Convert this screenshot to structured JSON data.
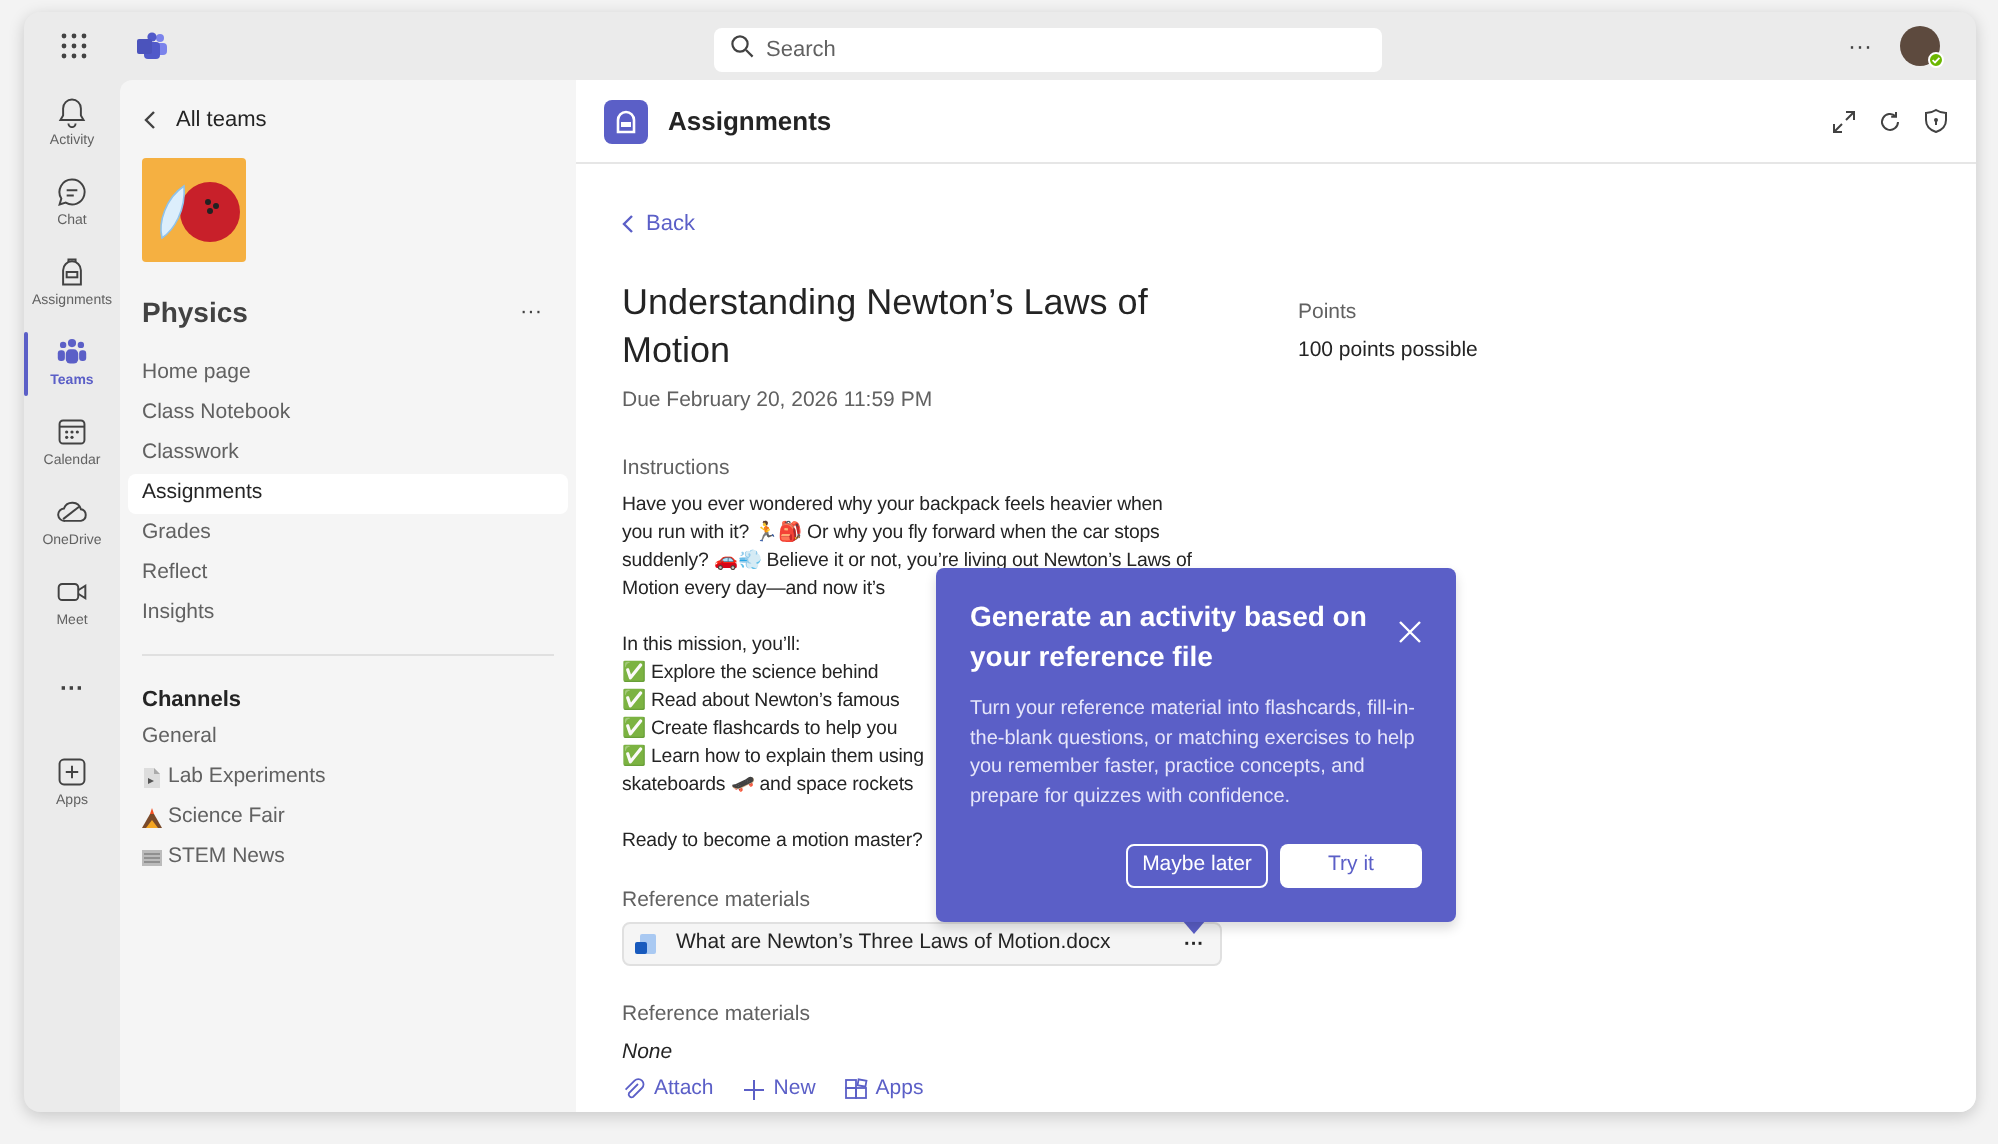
{
  "top_bar": {
    "search": {
      "placeholder": "Search"
    },
    "more": "···"
  },
  "rail": [
    {
      "kind": "bell",
      "label": "Activity",
      "selected": false
    },
    {
      "kind": "chat",
      "label": "Chat",
      "selected": false
    },
    {
      "kind": "backpack",
      "label": "Assignments",
      "selected": false
    },
    {
      "kind": "teams",
      "label": "Teams",
      "selected": true
    },
    {
      "kind": "calendar",
      "label": "Calendar",
      "selected": false
    },
    {
      "kind": "cloud",
      "label": "OneDrive",
      "selected": false
    },
    {
      "kind": "camera",
      "label": "Meet",
      "selected": false
    },
    {
      "kind": "more",
      "label": "···",
      "selected": false
    },
    {
      "kind": "apps",
      "label": "Apps",
      "selected": false
    }
  ],
  "team_panel": {
    "back": "All teams",
    "team_name": "Physics",
    "more": "···",
    "nav": [
      {
        "label": "Home page",
        "selected": false
      },
      {
        "label": "Class Notebook",
        "selected": false
      },
      {
        "label": "Classwork",
        "selected": false
      },
      {
        "label": "Assignments",
        "selected": true
      },
      {
        "label": "Grades",
        "selected": false
      },
      {
        "label": "Reflect",
        "selected": false
      },
      {
        "label": "Insights",
        "selected": false
      }
    ],
    "channels_heading": "Channels",
    "channels": [
      {
        "kind": "plain",
        "label": "General"
      },
      {
        "kind": "document",
        "label": "Lab Experiments"
      },
      {
        "kind": "volcano",
        "label": "Science Fair"
      },
      {
        "kind": "newspaper",
        "label": "STEM News"
      }
    ]
  },
  "main": {
    "title": "Assignments",
    "back": "Back",
    "assignment": {
      "title": "Understanding Newton’s Laws of Motion",
      "due": "Due February 20, 2026 11:59 PM",
      "instructions_label": "Instructions",
      "instructions_paragraphs": [
        [
          "Have you ever wondered why your backpack feels heavier when",
          "you run with it? 🏃🎒 Or why you fly forward when the car stops",
          "suddenly? 🚗💨 Believe it or not, you’re living out Newton’s Laws of",
          "Motion every day—and now it’s"
        ],
        [
          "In this mission, you’ll:",
          "✅ Explore the science behind",
          "✅ Read about Newton’s famous",
          "✅ Create flashcards to help you",
          "✅ Learn how to explain them using",
          "skateboards 🛹 and space rockets"
        ],
        [
          "Ready to become a motion master?"
        ]
      ],
      "reference_label": "Reference materials",
      "reference_file": {
        "name": "What are Newton’s Three Laws of Motion.docx",
        "more": "···"
      },
      "reference_label_2": "Reference materials",
      "reference_value_2": "None",
      "actions": [
        {
          "kind": "attach",
          "label": "Attach"
        },
        {
          "kind": "new",
          "label": "New"
        },
        {
          "kind": "apps",
          "label": "Apps"
        }
      ],
      "points_label": "Points",
      "points_value": "100 points possible"
    }
  },
  "popup": {
    "title": "Generate an activity based on your reference file",
    "body": "Turn your reference material into flashcards, fill-in-the-blank questions, or matching exercises to help you remember faster, practice concepts, and prepare for quizzes with confidence.",
    "buttons": [
      {
        "kind": "secondary",
        "label": "Maybe later"
      },
      {
        "kind": "primary",
        "label": "Try it"
      }
    ]
  }
}
